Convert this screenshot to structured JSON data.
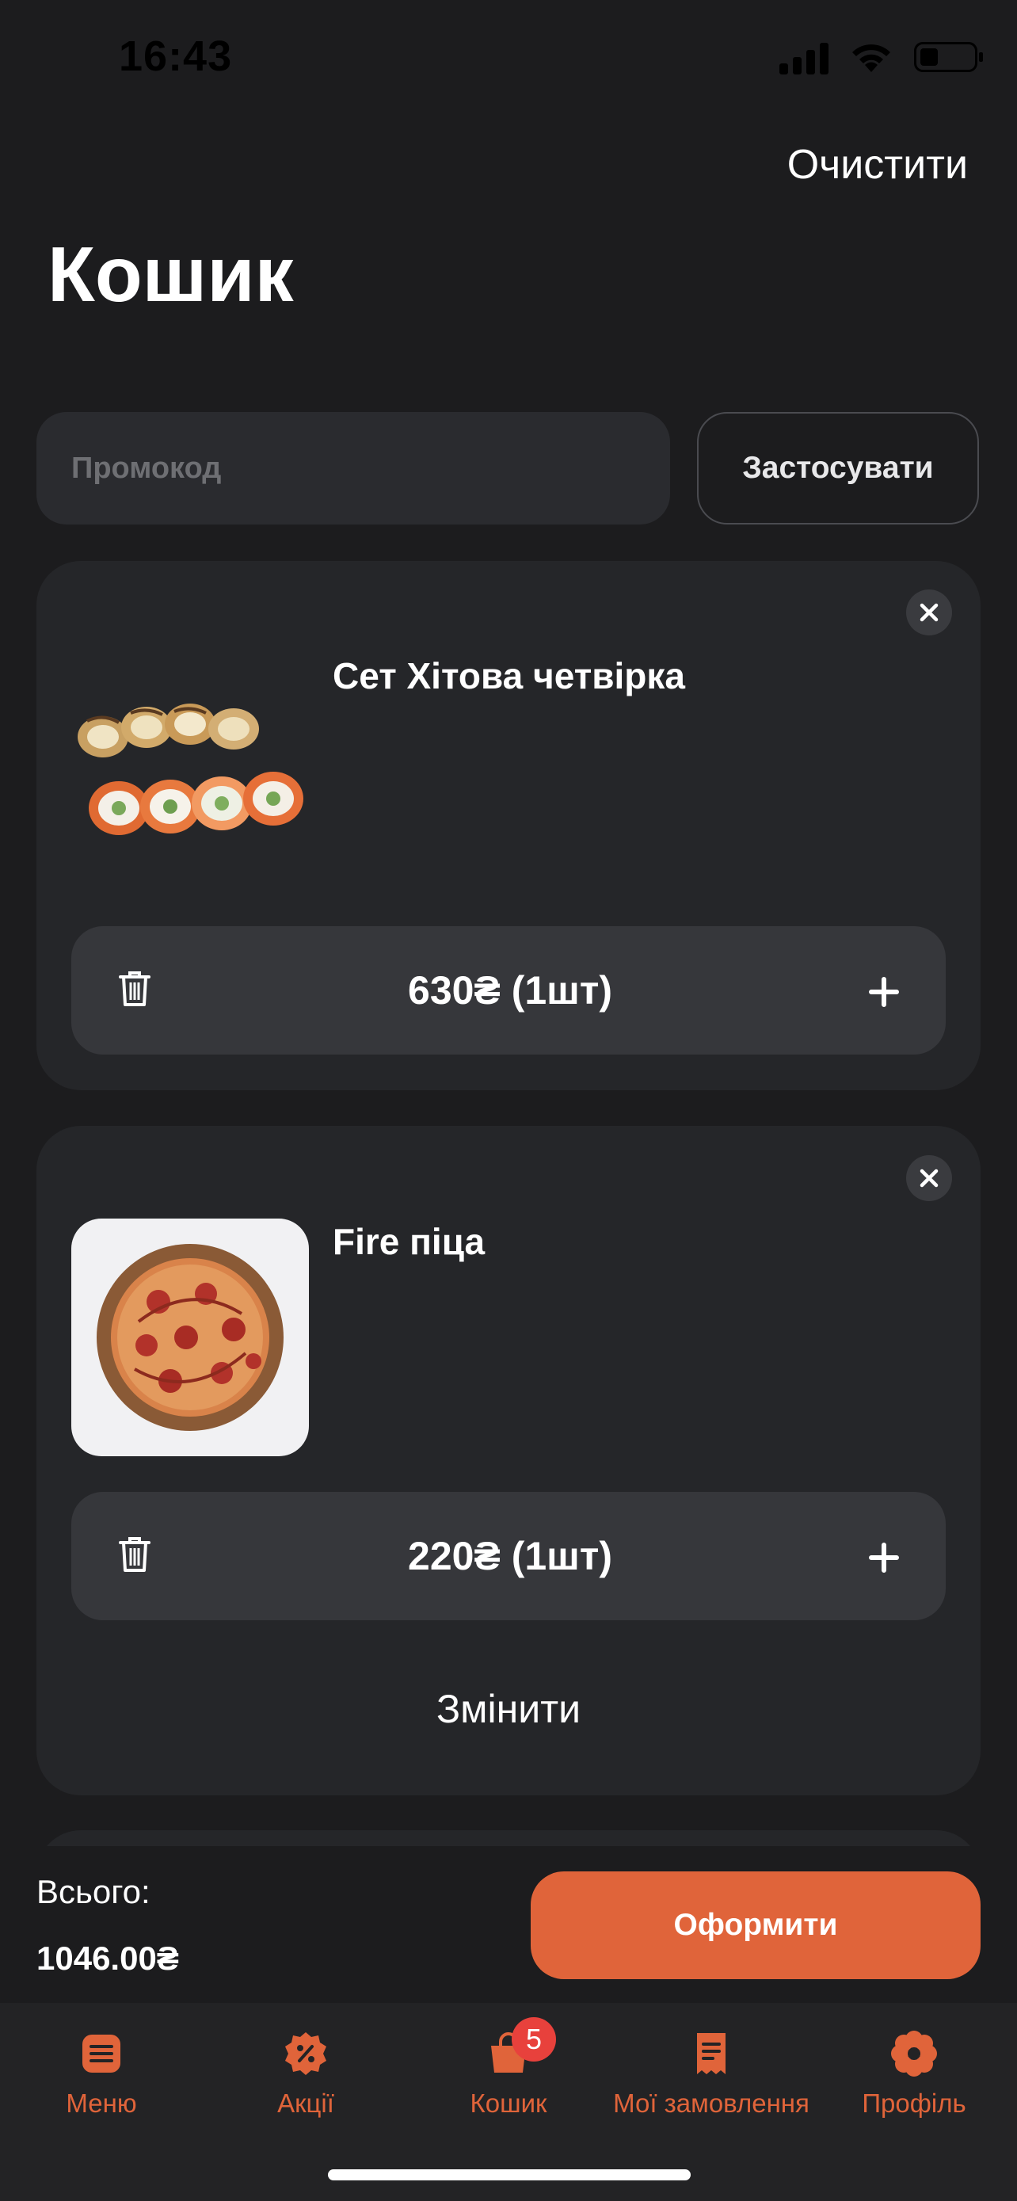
{
  "status_bar": {
    "time": "16:43"
  },
  "header": {
    "clear_label": "Очистити",
    "title": "Кошик"
  },
  "promo": {
    "placeholder": "Промокод",
    "apply_label": "Застосувати"
  },
  "cart_items": [
    {
      "name": "Сет Хітова четвірка",
      "qty_text": "630₴  (1шт)",
      "image": "sushi-set"
    },
    {
      "name": "Fire піца",
      "qty_text": "220₴  (1шт)",
      "image": "pizza",
      "change_label": "Змінити"
    }
  ],
  "summary": {
    "total_label": "Всього:",
    "total_value": "1046.00₴",
    "checkout_label": "Оформити"
  },
  "tabbar": {
    "items": [
      {
        "label": "Меню",
        "icon": "menu-icon"
      },
      {
        "label": "Акції",
        "icon": "discount-icon"
      },
      {
        "label": "Кошик",
        "icon": "cart-icon",
        "badge": "5"
      },
      {
        "label": "Мої замовлення",
        "icon": "receipt-icon"
      },
      {
        "label": "Профіль",
        "icon": "profile-icon"
      }
    ]
  },
  "colors": {
    "background": "#1c1c1e",
    "card": "#252629",
    "accent": "#e0643a",
    "badge": "#e8413c"
  }
}
